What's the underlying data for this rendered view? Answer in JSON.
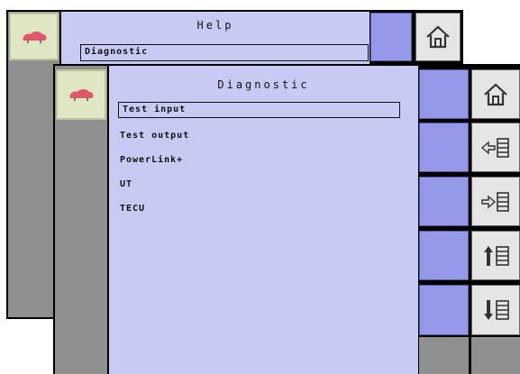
{
  "back_screen": {
    "title": "Help",
    "field_value": "Diagnostic"
  },
  "front_screen": {
    "title": "Diagnostic",
    "menu": [
      {
        "label": "Test input",
        "selected": true
      },
      {
        "label": "Test output",
        "selected": false
      },
      {
        "label": "PowerLink+",
        "selected": false
      },
      {
        "label": "UT",
        "selected": false
      },
      {
        "label": "TECU",
        "selected": false
      }
    ]
  },
  "icons": {
    "logo": "cloud-logo-icon",
    "home": "home-icon",
    "list_left": "list-arrow-left-icon",
    "list_right": "list-arrow-right-icon",
    "list_up": "list-arrow-up-icon",
    "list_down": "list-arrow-down-icon"
  },
  "colors": {
    "panel": "#c7caf2",
    "button": "#9699e9",
    "sidebar": "#8f8f8f",
    "icon_bg": "#e5e5e5"
  }
}
